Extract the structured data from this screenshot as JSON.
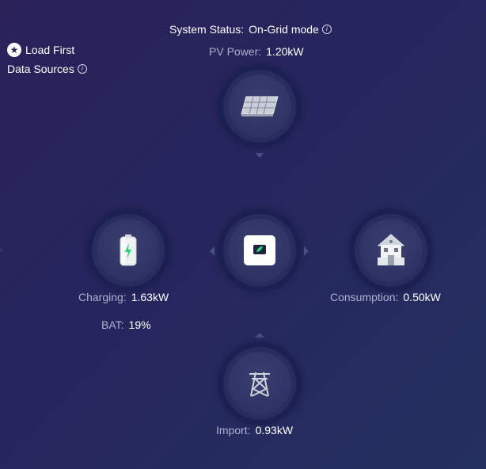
{
  "header": {
    "status_label": "System Status:",
    "status_value": "On-Grid mode",
    "pv_label": "PV Power:",
    "pv_value": "1.20kW"
  },
  "mode": {
    "label": "Load First",
    "data_sources_label": "Data Sources"
  },
  "battery": {
    "charging_label": "Charging:",
    "charging_value": "1.63kW",
    "bat_label": "BAT:",
    "bat_value": "19%",
    "level": 0.19
  },
  "consumption": {
    "label": "Consumption:",
    "value": "0.50kW"
  },
  "grid": {
    "label": "Import:",
    "value": "0.93kW"
  },
  "colors": {
    "accent_green": "#2fd27a",
    "label_gray": "#aeb0cf"
  },
  "icons": {
    "pv": "solar-panel-icon",
    "battery": "battery-charging-icon",
    "inverter": "inverter-icon",
    "home": "house-icon",
    "grid": "power-tower-icon"
  }
}
